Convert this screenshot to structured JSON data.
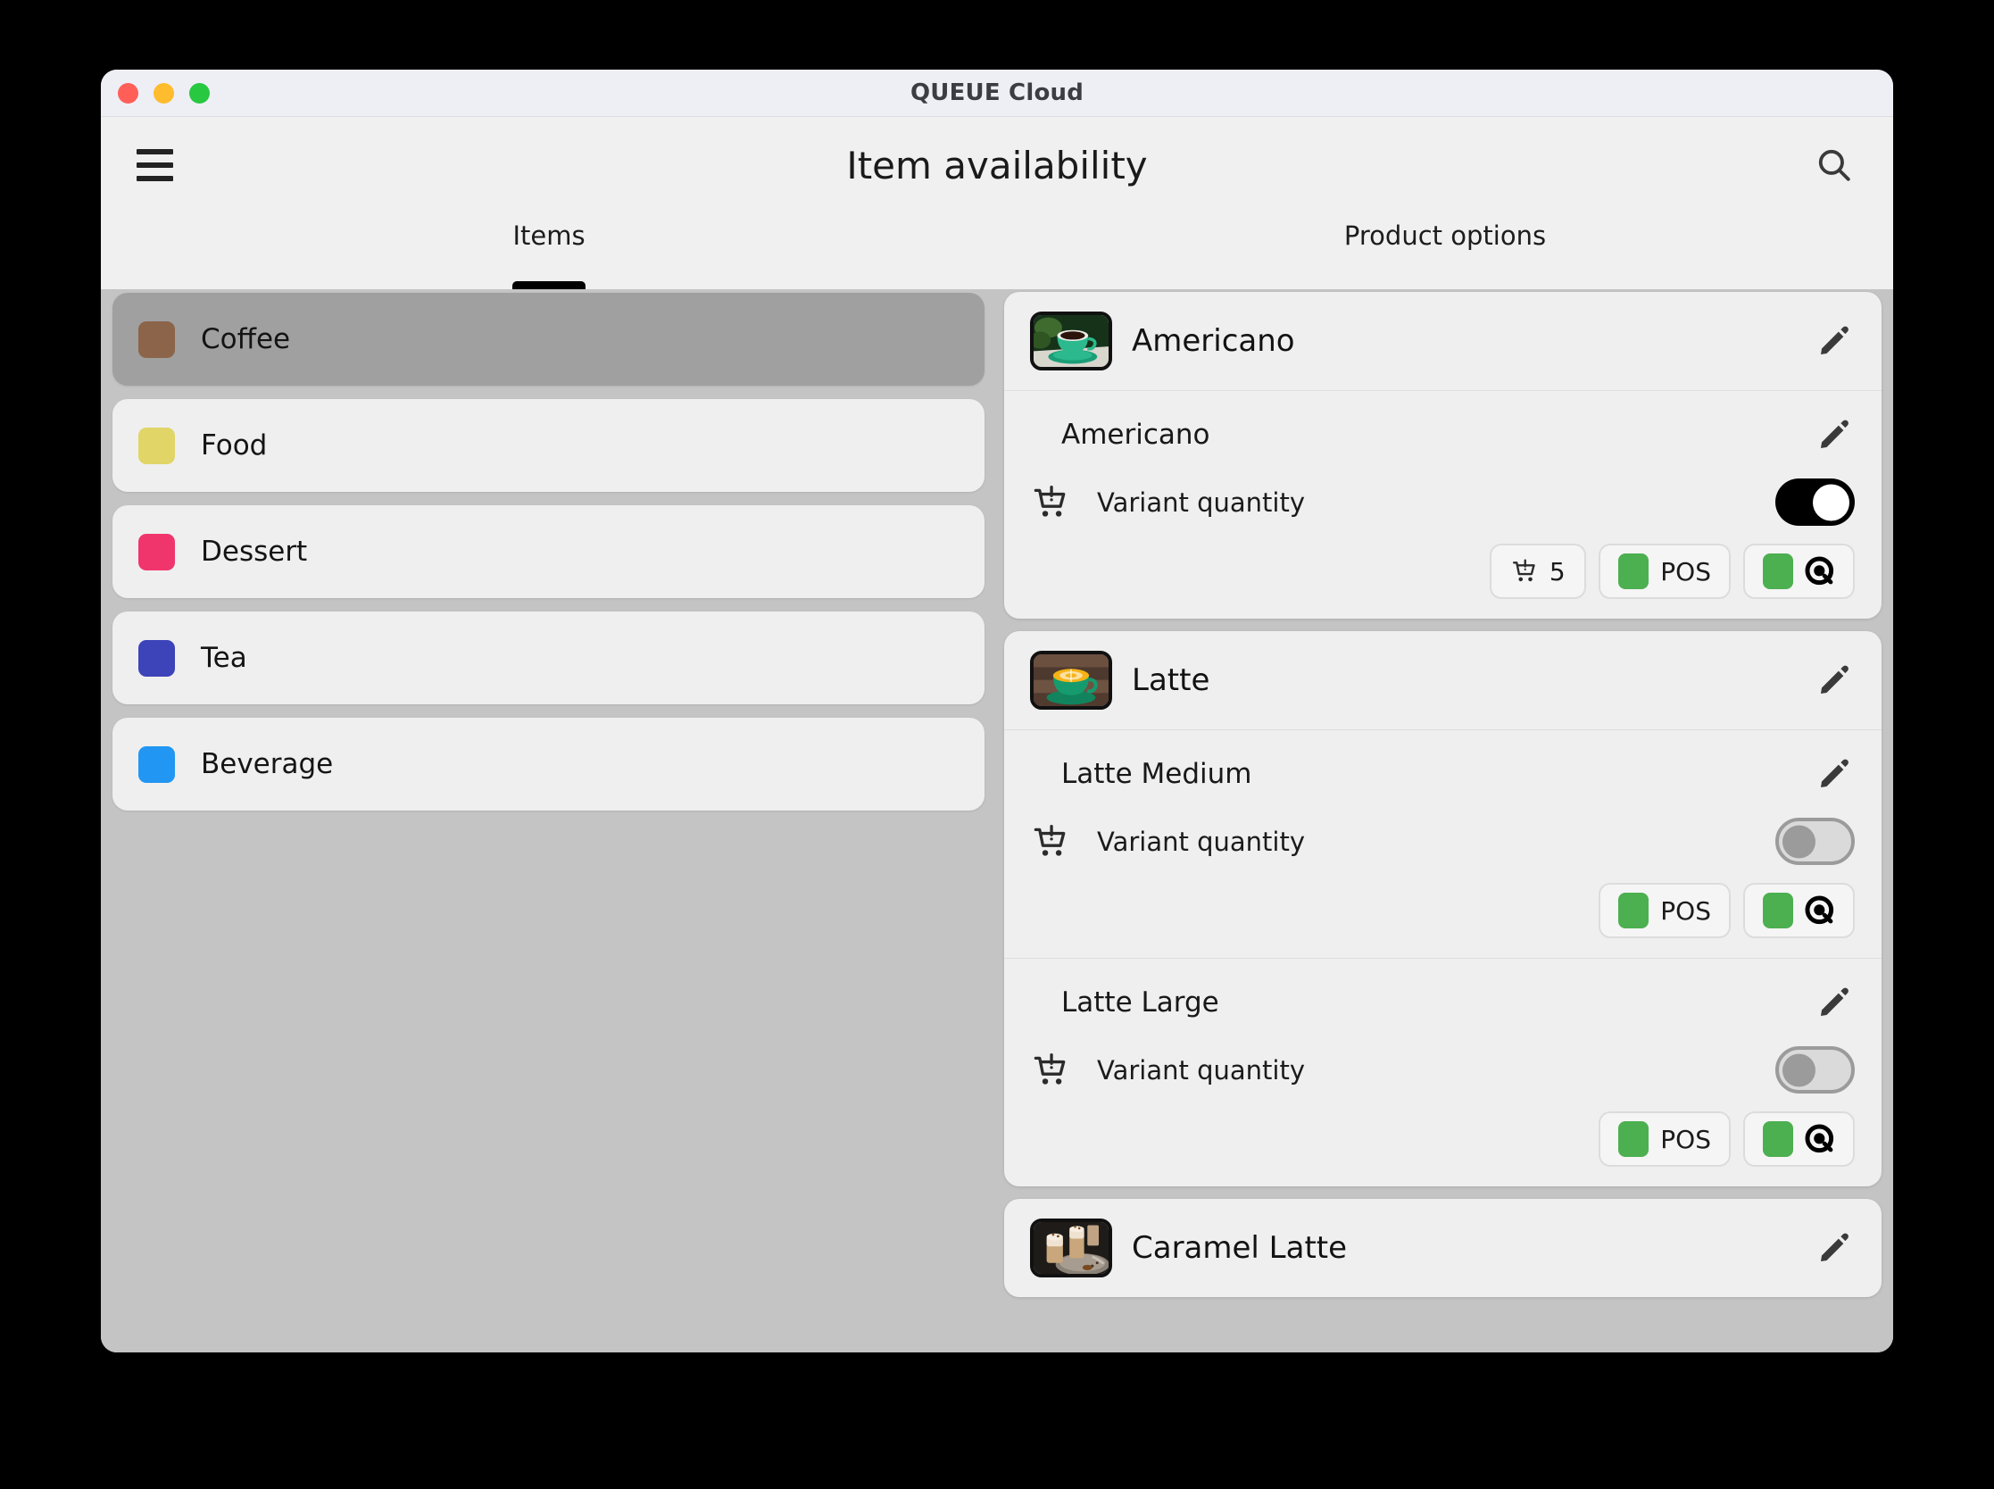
{
  "window": {
    "title": "QUEUE Cloud",
    "traffic_lights": [
      "close-button",
      "minimize-button",
      "maximize-button"
    ]
  },
  "header": {
    "title": "Item availability",
    "menu_icon": "hamburger-icon",
    "search_icon": "search-icon"
  },
  "tabs": [
    {
      "label": "Items",
      "active": true
    },
    {
      "label": "Product options",
      "active": false
    }
  ],
  "categories": [
    {
      "label": "Coffee",
      "color": "#8B6449",
      "selected": true
    },
    {
      "label": "Food",
      "color": "#E0D566",
      "selected": false
    },
    {
      "label": "Dessert",
      "color": "#F0356D",
      "selected": false
    },
    {
      "label": "Tea",
      "color": "#3D43B8",
      "selected": false
    },
    {
      "label": "Beverage",
      "color": "#2196F3",
      "selected": false
    }
  ],
  "products": [
    {
      "name": "Americano",
      "thumb": "americano-photo",
      "edit_icon": "pencil-icon",
      "variants": [
        {
          "name": "Americano",
          "edit_icon": "pencil-icon",
          "quantity_label": "Variant quantity",
          "cart_icon": "cart-alert-icon",
          "toggle_state": "on",
          "badges": [
            {
              "type": "quantity",
              "icon": "cart-icon",
              "text": "5"
            },
            {
              "type": "channel",
              "swatch": "#4CAF50",
              "text": "POS"
            },
            {
              "type": "channel",
              "swatch": "#4CAF50",
              "icon": "queue-logo-icon"
            }
          ]
        }
      ]
    },
    {
      "name": "Latte",
      "thumb": "latte-photo",
      "edit_icon": "pencil-icon",
      "variants": [
        {
          "name": "Latte Medium",
          "edit_icon": "pencil-icon",
          "quantity_label": "Variant quantity",
          "cart_icon": "cart-alert-icon",
          "toggle_state": "off",
          "badges": [
            {
              "type": "channel",
              "swatch": "#4CAF50",
              "text": "POS"
            },
            {
              "type": "channel",
              "swatch": "#4CAF50",
              "icon": "queue-logo-icon"
            }
          ]
        },
        {
          "name": "Latte Large",
          "edit_icon": "pencil-icon",
          "quantity_label": "Variant quantity",
          "cart_icon": "cart-alert-icon",
          "toggle_state": "off",
          "badges": [
            {
              "type": "channel",
              "swatch": "#4CAF50",
              "text": "POS"
            },
            {
              "type": "channel",
              "swatch": "#4CAF50",
              "icon": "queue-logo-icon"
            }
          ]
        }
      ]
    },
    {
      "name": "Caramel Latte",
      "thumb": "caramel-latte-photo",
      "edit_icon": "pencil-icon",
      "variants": []
    }
  ],
  "colors": {
    "accent_green": "#4CAF50",
    "selected_category": "#A0A0A0",
    "panel_background": "#C4C4C4",
    "card_background": "#EFEFEF",
    "titlebar": "#EEEEF5"
  }
}
